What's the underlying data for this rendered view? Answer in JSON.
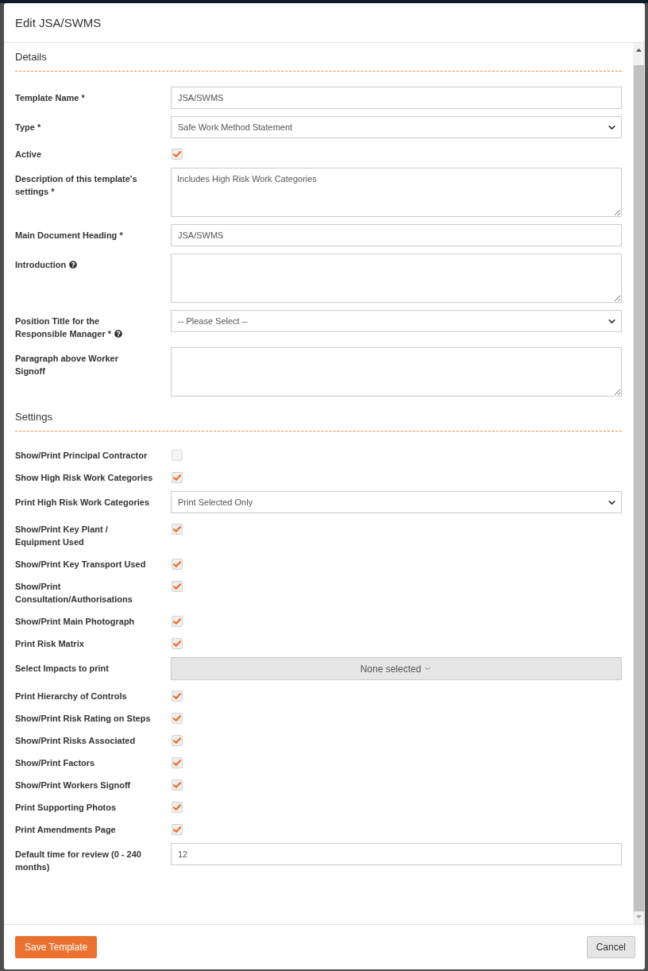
{
  "dialog": {
    "title": "Edit JSA/SWMS"
  },
  "sections": [
    {
      "title": "Details",
      "fields": [
        {
          "kind": "text",
          "label": "Template Name *",
          "help": false,
          "value": "JSA/SWMS"
        },
        {
          "kind": "select",
          "label": "Type *",
          "help": false,
          "value": "Safe Work Method Statement"
        },
        {
          "kind": "checkbox",
          "label": "Active",
          "help": false,
          "checked": true
        },
        {
          "kind": "textarea",
          "label": "Description of this template's settings *",
          "help": false,
          "value": "Includes High Risk Work Categories"
        },
        {
          "kind": "text",
          "label": "Main Document Heading *",
          "help": false,
          "value": "JSA/SWMS"
        },
        {
          "kind": "textarea",
          "label": "Introduction",
          "help": true
        },
        {
          "kind": "select",
          "label": "Position Title for the Responsible Manager *",
          "help": true,
          "value": "-- Please Select --"
        },
        {
          "kind": "textarea",
          "label": "Paragraph above Worker Signoff",
          "help": false
        }
      ]
    },
    {
      "title": "Settings",
      "fields": [
        {
          "kind": "checkbox",
          "label": "Show/Print Principal Contractor",
          "help": false,
          "checked": false
        },
        {
          "kind": "checkbox",
          "label": "Show High Risk Work Categories",
          "help": false,
          "checked": true
        },
        {
          "kind": "select",
          "label": "Print High Risk Work Categories",
          "help": false,
          "value": "Print Selected Only"
        },
        {
          "kind": "checkbox",
          "label": "Show/Print Key Plant / Equipment Used",
          "help": false,
          "checked": true
        },
        {
          "kind": "checkbox",
          "label": "Show/Print Key Transport Used",
          "help": false,
          "checked": true
        },
        {
          "kind": "checkbox",
          "label": "Show/Print Consultation/Authorisations",
          "help": false,
          "checked": true
        },
        {
          "kind": "checkbox",
          "label": "Show/Print Main Photograph",
          "help": false,
          "checked": true
        },
        {
          "kind": "checkbox",
          "label": "Print Risk Matrix",
          "help": false,
          "checked": true
        },
        {
          "kind": "multiselect",
          "label": "Select Impacts to print",
          "help": false,
          "value": "None selected"
        },
        {
          "kind": "checkbox",
          "label": "Print Hierarchy of Controls",
          "help": false,
          "checked": true
        },
        {
          "kind": "checkbox",
          "label": "Show/Print Risk Rating on Steps",
          "help": false,
          "checked": true
        },
        {
          "kind": "checkbox",
          "label": "Show/Print Risks Associated",
          "help": false,
          "checked": true
        },
        {
          "kind": "checkbox",
          "label": "Show/Print Factors",
          "help": false,
          "checked": true
        },
        {
          "kind": "checkbox",
          "label": "Show/Print Workers Signoff",
          "help": false,
          "checked": true
        },
        {
          "kind": "checkbox",
          "label": "Print Supporting Photos",
          "help": false,
          "checked": true
        },
        {
          "kind": "checkbox",
          "label": "Print Amendments Page",
          "help": false,
          "checked": true
        },
        {
          "kind": "text",
          "label": "Default time for review (0 - 240 months)",
          "help": false,
          "value": "12"
        }
      ]
    }
  ],
  "buttons": [
    {
      "kind": "primary",
      "label": "Save Template"
    },
    {
      "kind": "secondary",
      "label": "Cancel"
    }
  ]
}
